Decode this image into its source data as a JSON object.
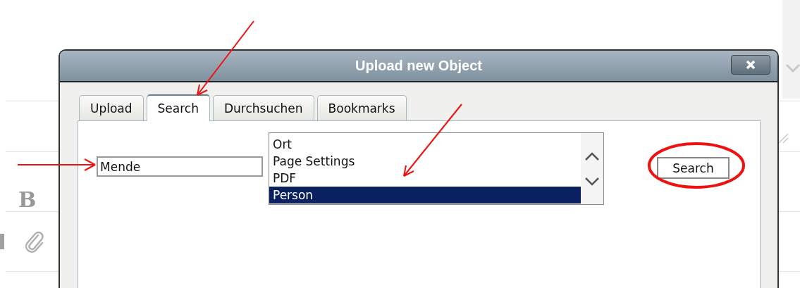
{
  "background_editor": {
    "bold_button": "B"
  },
  "dialog": {
    "title": "Upload new Object",
    "tabs": [
      {
        "label": "Upload",
        "selected": false
      },
      {
        "label": "Search",
        "selected": true
      },
      {
        "label": "Durchsuchen",
        "selected": false
      },
      {
        "label": "Bookmarks",
        "selected": false
      }
    ],
    "search_field": {
      "value": "Mende"
    },
    "type_list": [
      {
        "label": "Ort",
        "selected": false
      },
      {
        "label": "Page Settings",
        "selected": false
      },
      {
        "label": "PDF",
        "selected": false
      },
      {
        "label": "Person",
        "selected": true
      }
    ],
    "search_button": "Search"
  }
}
